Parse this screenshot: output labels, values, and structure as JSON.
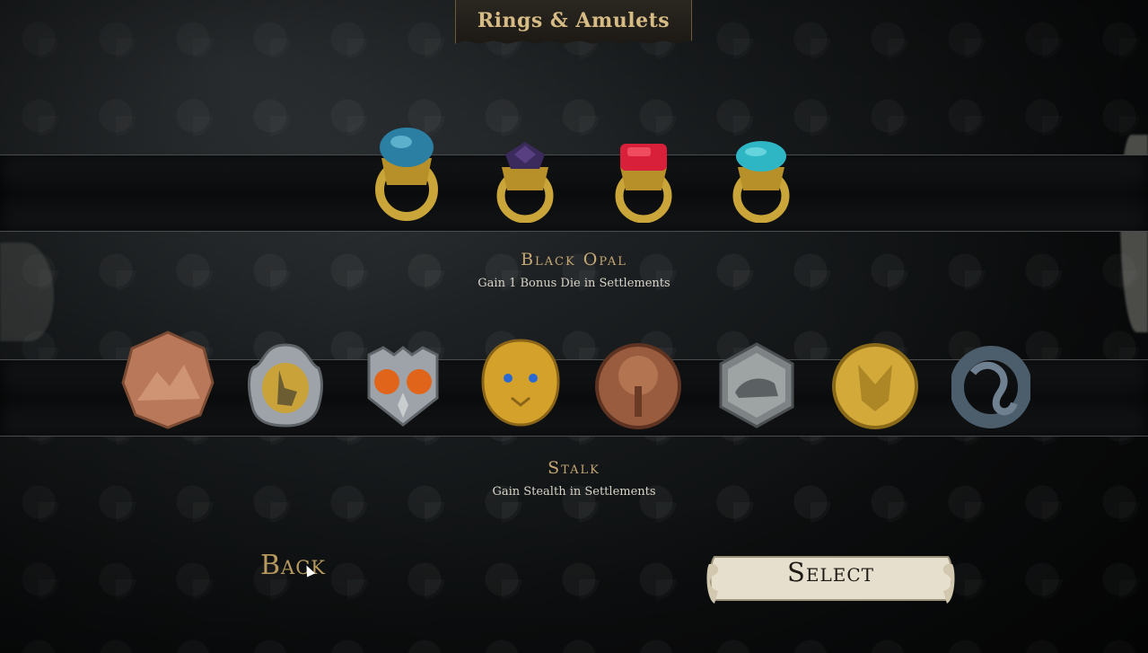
{
  "header": {
    "title": "Rings & Amulets"
  },
  "rings": {
    "items": [
      {
        "name": "ring-blue",
        "gem": "#2a7fa3"
      },
      {
        "name": "ring-black-opal",
        "gem": "#3b2a5c"
      },
      {
        "name": "ring-red",
        "gem": "#d8203a"
      },
      {
        "name": "ring-turquoise",
        "gem": "#2fb6c4"
      }
    ],
    "selected": {
      "title": "Black Opal",
      "desc": "Gain 1 Bonus Die in Settlements"
    }
  },
  "amulets": {
    "items": [
      {
        "name": "amulet-mountain",
        "color": "#b9785a"
      },
      {
        "name": "amulet-hare",
        "color": "#c9a33a"
      },
      {
        "name": "amulet-owl",
        "color": "#9da3a8"
      },
      {
        "name": "amulet-lion",
        "color": "#d4a22a"
      },
      {
        "name": "amulet-tree",
        "color": "#9a5c3e"
      },
      {
        "name": "amulet-bear",
        "color": "#7d8284"
      },
      {
        "name": "amulet-wolf",
        "color": "#d3a93a"
      },
      {
        "name": "amulet-serpent",
        "color": "#4c5d6c"
      }
    ],
    "selected": {
      "title": "Stalk",
      "desc": "Gain Stealth in Settlements"
    }
  },
  "buttons": {
    "back": "Back",
    "select": "Select"
  }
}
